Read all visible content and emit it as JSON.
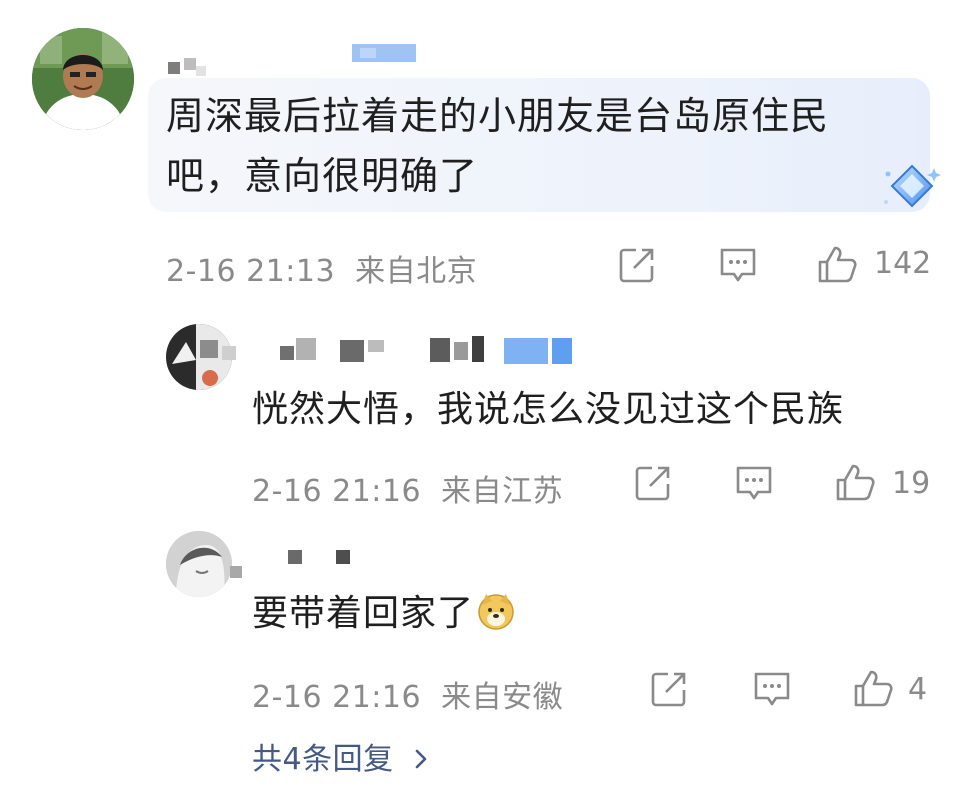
{
  "comment": {
    "text": "周深最后拉着走的小朋友是台岛原住民吧，意向很明确了",
    "timestamp": "2-16 21:13",
    "location": "来自北京",
    "like_count": "142",
    "icons": [
      "share-icon",
      "comment-icon",
      "like-icon",
      "diamond-badge-icon"
    ]
  },
  "replies": [
    {
      "text": "恍然大悟，我说怎么没见过这个民族",
      "timestamp": "2-16 21:16",
      "location": "来自江苏",
      "like_count": "19"
    },
    {
      "text": "要带着回家了",
      "emoji": "doge-emoji-icon",
      "timestamp": "2-16 21:16",
      "location": "来自安徽",
      "like_count": "4"
    }
  ],
  "more_replies_label": "共4条回复",
  "colors": {
    "meta_gray": "#8a8a8a",
    "link_blue": "#445a85",
    "bubble_start": "#f5f7fb",
    "bubble_end": "#e7eefb"
  }
}
